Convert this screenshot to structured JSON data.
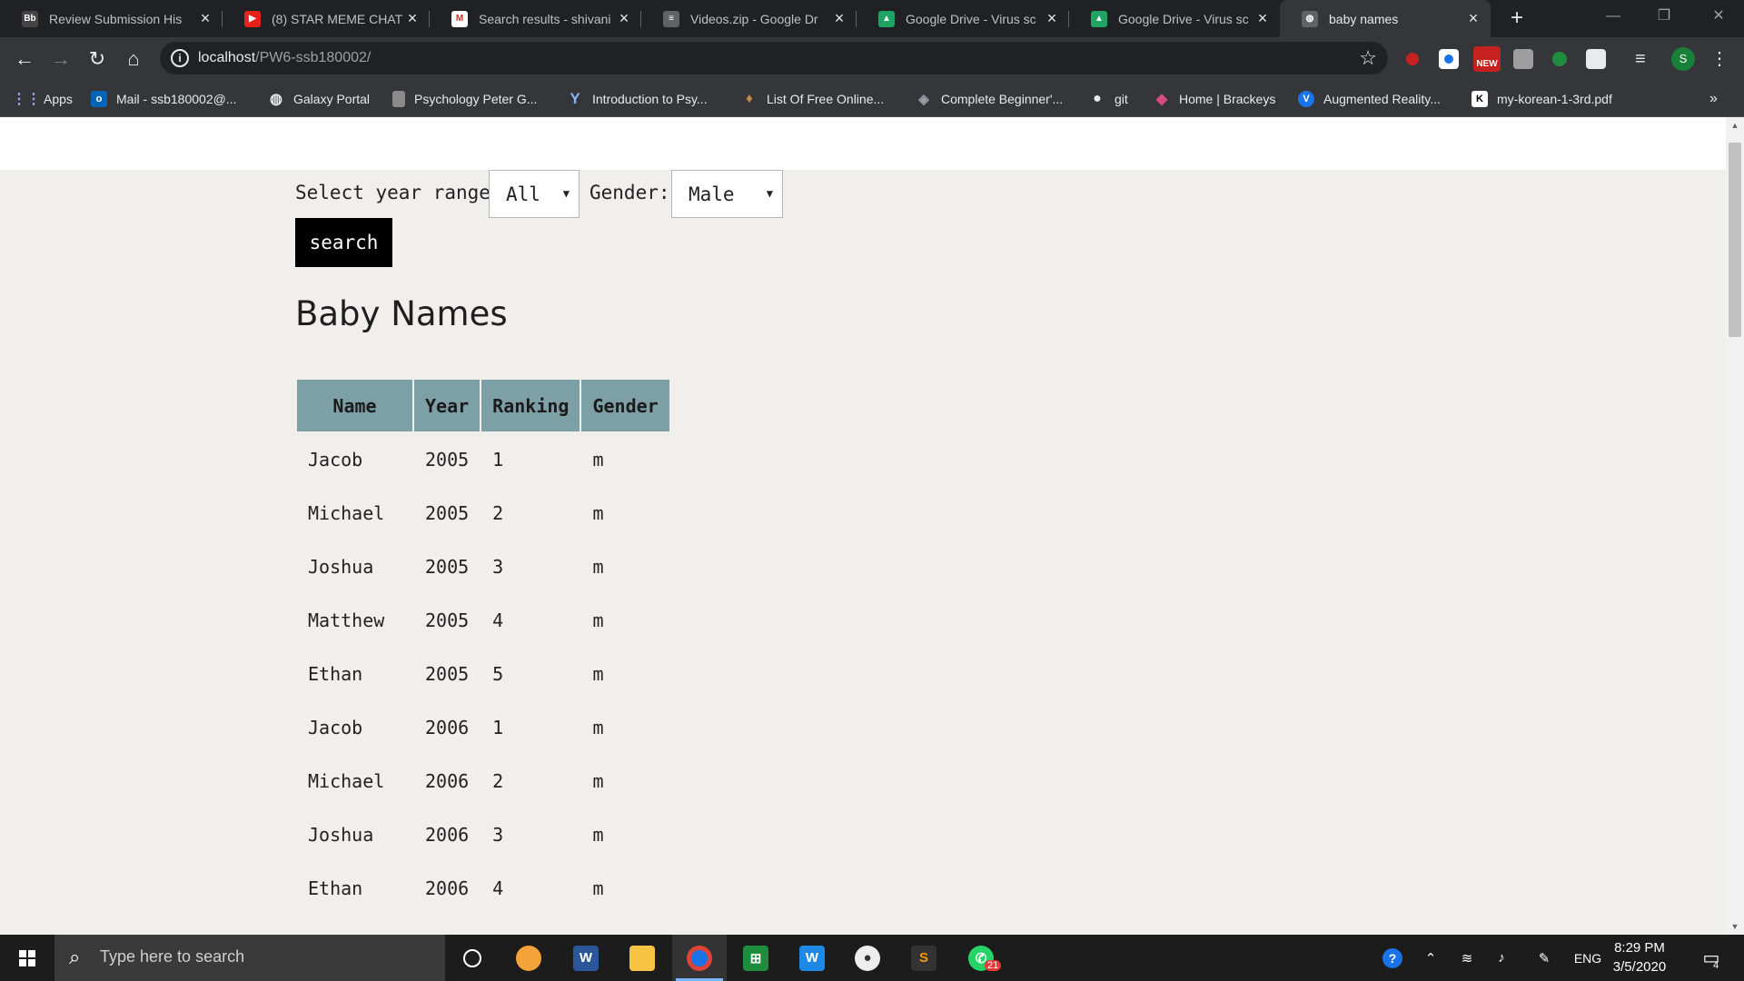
{
  "browser": {
    "tabs": [
      {
        "title": "Review Submission His",
        "favicon": "Bb"
      },
      {
        "title": "(8) STAR MEME CHAT(",
        "favicon": "youtube"
      },
      {
        "title": "Search results - shivani",
        "favicon": "gmail"
      },
      {
        "title": "Videos.zip - Google Dr",
        "favicon": "zip"
      },
      {
        "title": "Google Drive - Virus sc",
        "favicon": "drive"
      },
      {
        "title": "Google Drive - Virus sc",
        "favicon": "drive"
      },
      {
        "title": "baby names",
        "favicon": "globe"
      }
    ],
    "url_host": "localhost",
    "url_path": "/PW6-ssb180002/",
    "bookmarks": [
      {
        "label": "Apps"
      },
      {
        "label": "Mail - ssb180002@..."
      },
      {
        "label": "Galaxy Portal"
      },
      {
        "label": "Psychology Peter G..."
      },
      {
        "label": "Introduction to Psy..."
      },
      {
        "label": "List Of Free Online..."
      },
      {
        "label": "Complete Beginner'..."
      },
      {
        "label": "git"
      },
      {
        "label": "Home | Brackeys"
      },
      {
        "label": "Augmented Reality..."
      },
      {
        "label": "my-korean-1-3rd.pdf"
      }
    ],
    "ext_badge": "NEW",
    "profile_initial": "S",
    "more_bookmarks": "»"
  },
  "form": {
    "year_label": "Select year range:",
    "year_value": "All",
    "gender_label": "Gender:",
    "gender_value": "Male",
    "search_label": "search"
  },
  "heading": "Baby Names",
  "table": {
    "headers": [
      "Name",
      "Year",
      "Ranking",
      "Gender"
    ],
    "rows": [
      [
        "Jacob",
        "2005",
        "1",
        "m"
      ],
      [
        "Michael",
        "2005",
        "2",
        "m"
      ],
      [
        "Joshua",
        "2005",
        "3",
        "m"
      ],
      [
        "Matthew",
        "2005",
        "4",
        "m"
      ],
      [
        "Ethan",
        "2005",
        "5",
        "m"
      ],
      [
        "Jacob",
        "2006",
        "1",
        "m"
      ],
      [
        "Michael",
        "2006",
        "2",
        "m"
      ],
      [
        "Joshua",
        "2006",
        "3",
        "m"
      ],
      [
        "Ethan",
        "2006",
        "4",
        "m"
      ]
    ]
  },
  "taskbar": {
    "search_placeholder": "Type here to search",
    "whatsapp_badge": "21",
    "lang": "ENG",
    "time": "8:29 PM",
    "date": "3/5/2020",
    "notifications": "4"
  }
}
